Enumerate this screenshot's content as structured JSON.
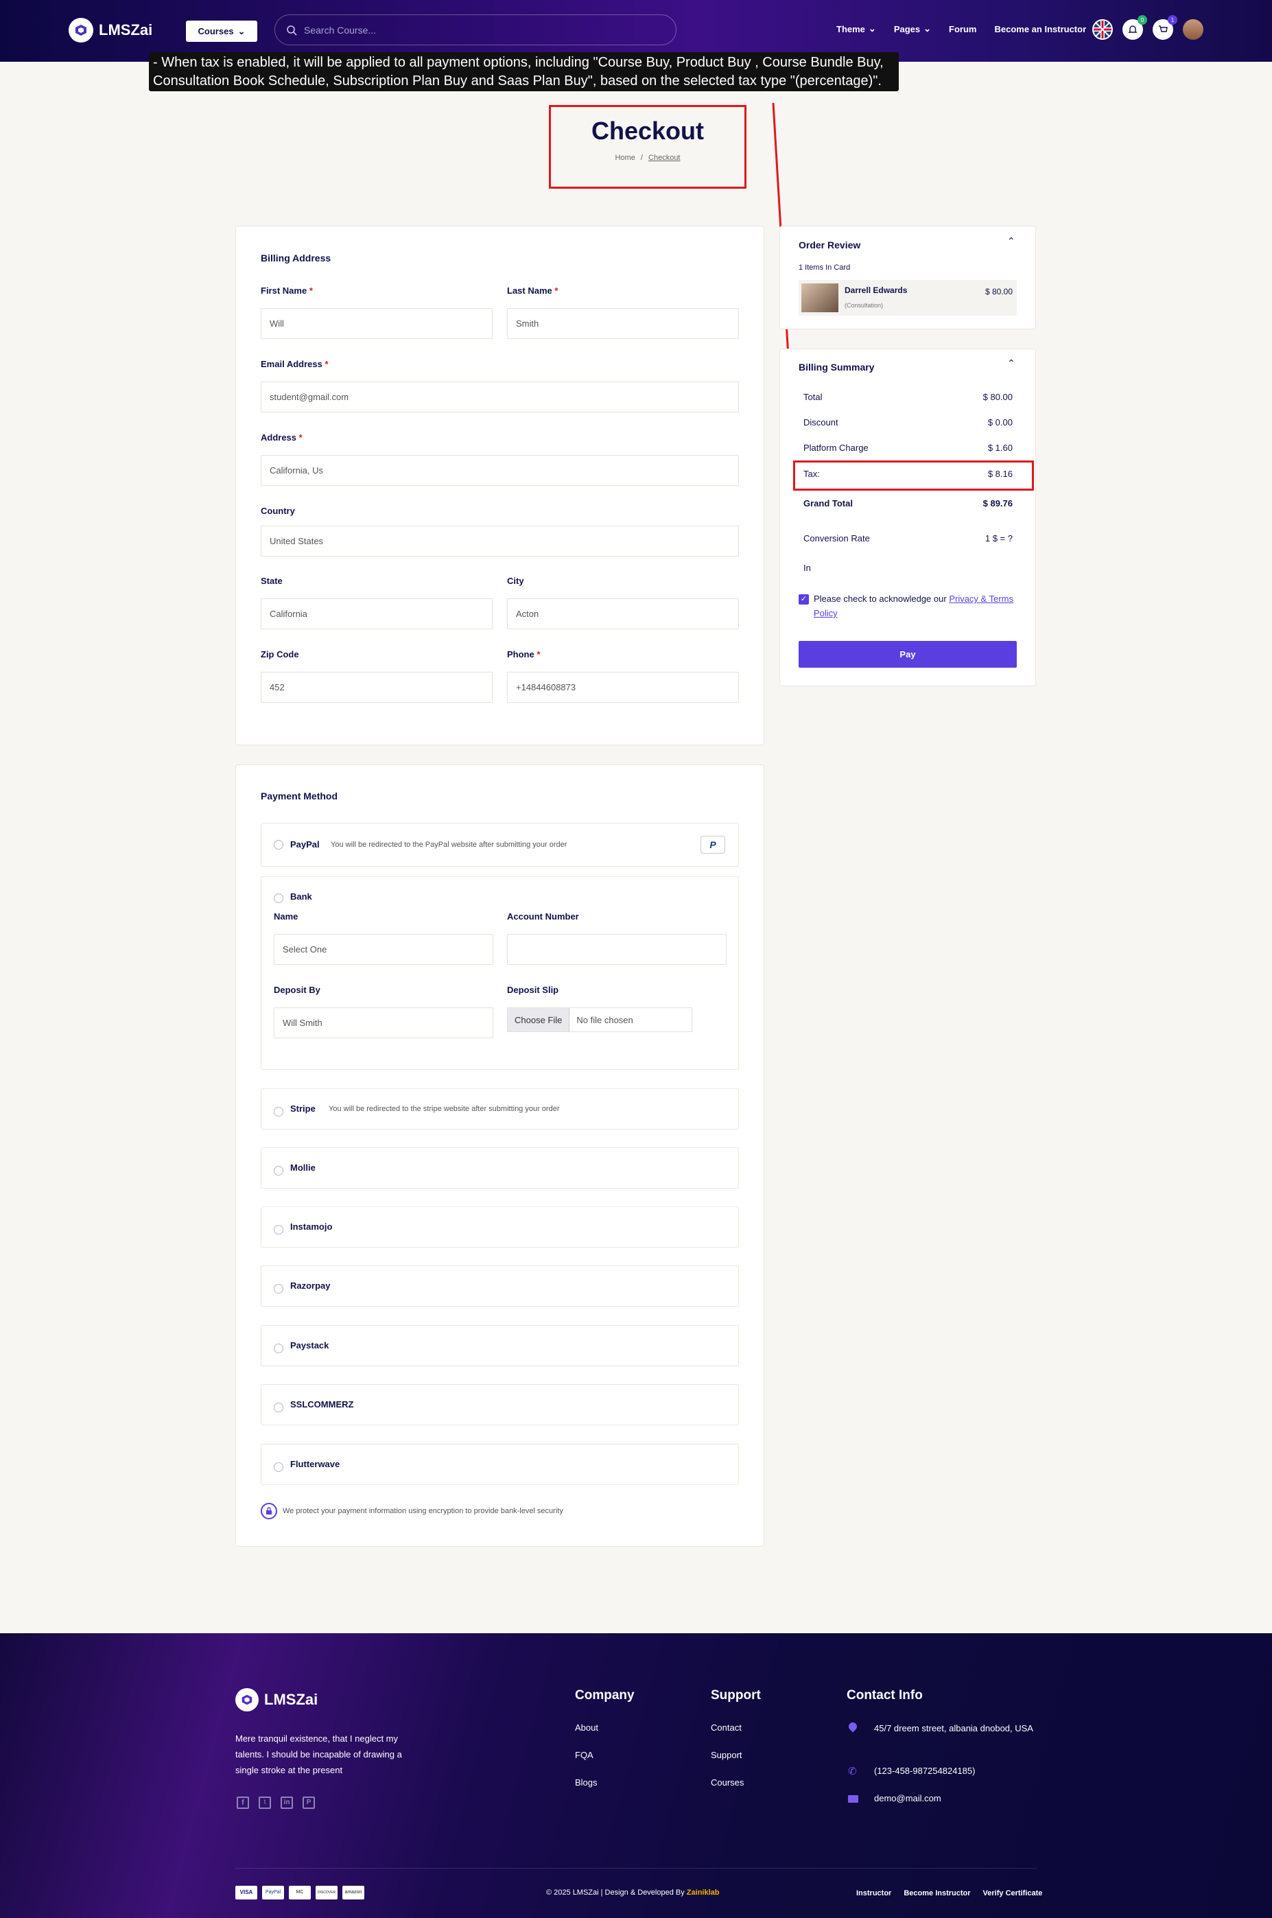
{
  "header": {
    "logo_text": "LMSZai",
    "courses_label": "Courses",
    "search_placeholder": "Search Course...",
    "nav": [
      "Theme",
      "Pages",
      "Forum",
      "Become an Instructor"
    ],
    "notif_badge": "0",
    "cart_badge": "1"
  },
  "tooltip": {
    "text": "- When tax is enabled, it will be applied to all payment options, including \"Course Buy, Product Buy , Course Bundle Buy, Consultation Book Schedule, Subscription Plan Buy and Saas Plan Buy\", based on the selected tax type \"(percentage)\"."
  },
  "page": {
    "title": "Checkout",
    "breadcrumb_home": "Home",
    "breadcrumb_sep": "/",
    "breadcrumb_current": "Checkout"
  },
  "billing": {
    "title": "Billing Address",
    "first_name_label": "First Name",
    "first_name_value": "Will",
    "last_name_label": "Last Name",
    "last_name_value": "Smith",
    "email_label": "Email Address",
    "email_value": "student@gmail.com",
    "address_label": "Address",
    "address_value": "California, Us",
    "country_label": "Country",
    "country_value": "United States",
    "state_label": "State",
    "state_value": "California",
    "city_label": "City",
    "city_value": "Acton",
    "zip_label": "Zip Code",
    "zip_value": "452",
    "phone_label": "Phone",
    "phone_value": "+14844608873"
  },
  "payment": {
    "title": "Payment Method",
    "paypal_name": "PayPal",
    "paypal_desc": "You will be redirected to the PayPal website after submitting your order",
    "bank_name": "Bank",
    "bank_name_label": "Name",
    "bank_name_value": "Select One",
    "account_label": "Account Number",
    "account_value": "",
    "deposit_by_label": "Deposit By",
    "deposit_by_value": "Will Smith",
    "deposit_slip_label": "Deposit Slip",
    "choose_file": "Choose File",
    "no_file": "No file chosen",
    "stripe_name": "Stripe",
    "stripe_desc": "You will be redirected to the stripe website after submitting your order",
    "others": [
      "Mollie",
      "Instamojo",
      "Razorpay",
      "Paystack",
      "SSLCOMMERZ",
      "Flutterwave"
    ],
    "secure_note": "We protect your payment information using encryption to provide bank-level security"
  },
  "order_review": {
    "title": "Order Review",
    "items_count": "1 Items In Card",
    "item_name": "Darrell Edwards",
    "item_type": "(Consultation)",
    "item_price": "$ 80.00"
  },
  "billing_summary": {
    "title": "Billing Summary",
    "total_label": "Total",
    "total_value": "$ 80.00",
    "discount_label": "Discount",
    "discount_value": "$ 0.00",
    "platform_label": "Platform Charge",
    "platform_value": "$ 1.60",
    "tax_label": "Tax:",
    "tax_value": "$ 8.16",
    "grand_label": "Grand Total",
    "grand_value": "$ 89.76",
    "conversion_label": "Conversion Rate",
    "conversion_value": "1 $ = ?",
    "in_label": "In",
    "ack_text": "Please check to acknowledge our",
    "ack_link": "Privacy & Terms Policy",
    "pay_label": "Pay"
  },
  "footer": {
    "logo_text": "LMSZai",
    "tagline": "Mere tranquil existence, that I neglect my talents. I should be incapable of drawing a single stroke at the present",
    "company_title": "Company",
    "company_links": [
      "About",
      "FQA",
      "Blogs"
    ],
    "support_title": "Support",
    "support_links": [
      "Contact",
      "Support",
      "Courses"
    ],
    "contact_title": "Contact Info",
    "address": "45/7 dreem street, albania dnobod, USA",
    "phone": "(123-458-987254824185)",
    "email": "demo@mail.com",
    "payment_logos": [
      "VISA",
      "PayPal",
      "MC",
      "DISCOVER",
      "amazon"
    ],
    "copyright": "© 2025 LMSZai | Design & Developed By",
    "developer": "Zainiklab",
    "bottom_links": [
      "Instructor",
      "Become Instructor",
      "Verify Certificate"
    ]
  },
  "colors": {
    "accent": "#5b3ee0",
    "highlight": "#e0171c",
    "navy": "#12124a"
  }
}
